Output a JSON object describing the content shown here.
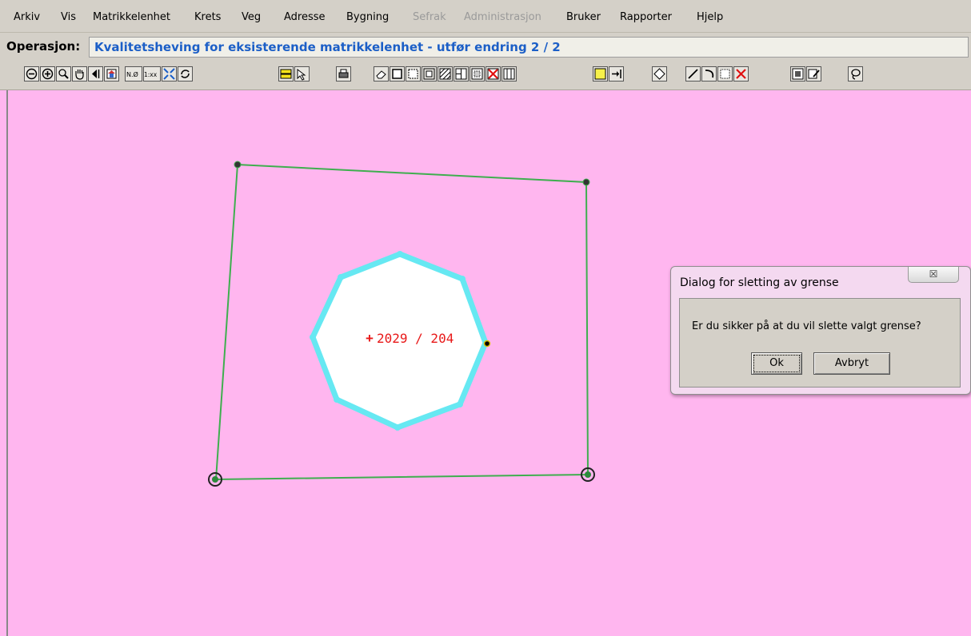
{
  "menu": {
    "items": [
      {
        "label": "Arkiv",
        "enabled": true
      },
      {
        "label": "Vis",
        "enabled": true
      },
      {
        "label": "Matrikkelenhet",
        "enabled": true
      },
      {
        "label": "Krets",
        "enabled": true
      },
      {
        "label": "Veg",
        "enabled": true
      },
      {
        "label": "Adresse",
        "enabled": true
      },
      {
        "label": "Bygning",
        "enabled": true
      },
      {
        "label": "Sefrak",
        "enabled": false
      },
      {
        "label": "Administrasjon",
        "enabled": false
      },
      {
        "label": "Bruker",
        "enabled": true
      },
      {
        "label": "Rapporter",
        "enabled": true
      },
      {
        "label": "Hjelp",
        "enabled": true
      }
    ]
  },
  "operation": {
    "label": "Operasjon:",
    "value": "Kvalitetsheving for eksisterende matrikkelenhet - utfør endring 2 / 2"
  },
  "toolbar": {
    "tools": [
      "zoom-out-icon",
      "zoom-in-icon",
      "zoom-window-icon",
      "pan-hand-icon",
      "previous-view-icon",
      "home-view-icon",
      "north-east-coord-icon",
      "scale-icon",
      "zoom-extent-icon",
      "refresh-icon",
      "layer-select-icon",
      "pointer-icon",
      "print-icon",
      "erase-icon",
      "rectangle-icon",
      "dashed-rectangle-icon",
      "inner-rectangle-icon",
      "hatched-rectangle-icon",
      "split-rectangle-icon",
      "grid-rectangle-icon",
      "delete-rectangle-icon",
      "column-rectangle-icon",
      "yellow-rectangle-icon",
      "move-to-end-icon",
      "diamond-icon",
      "line-icon",
      "arc-icon",
      "dotted-box-icon",
      "delete-icon",
      "frame-icon",
      "edit-icon",
      "lasso-icon"
    ]
  },
  "map": {
    "parcel_label": "2029 / 204",
    "colors": {
      "background": "#ffb6ef",
      "boundary": "#3fae4f",
      "selected_boundary": "#66e8f2",
      "label": "#e81818"
    }
  },
  "dialog": {
    "title": "Dialog for sletting av grense",
    "close_glyph": "☒",
    "message": "Er du sikker på at du vil slette valgt grense?",
    "ok_label": "Ok",
    "cancel_label": "Avbryt"
  }
}
